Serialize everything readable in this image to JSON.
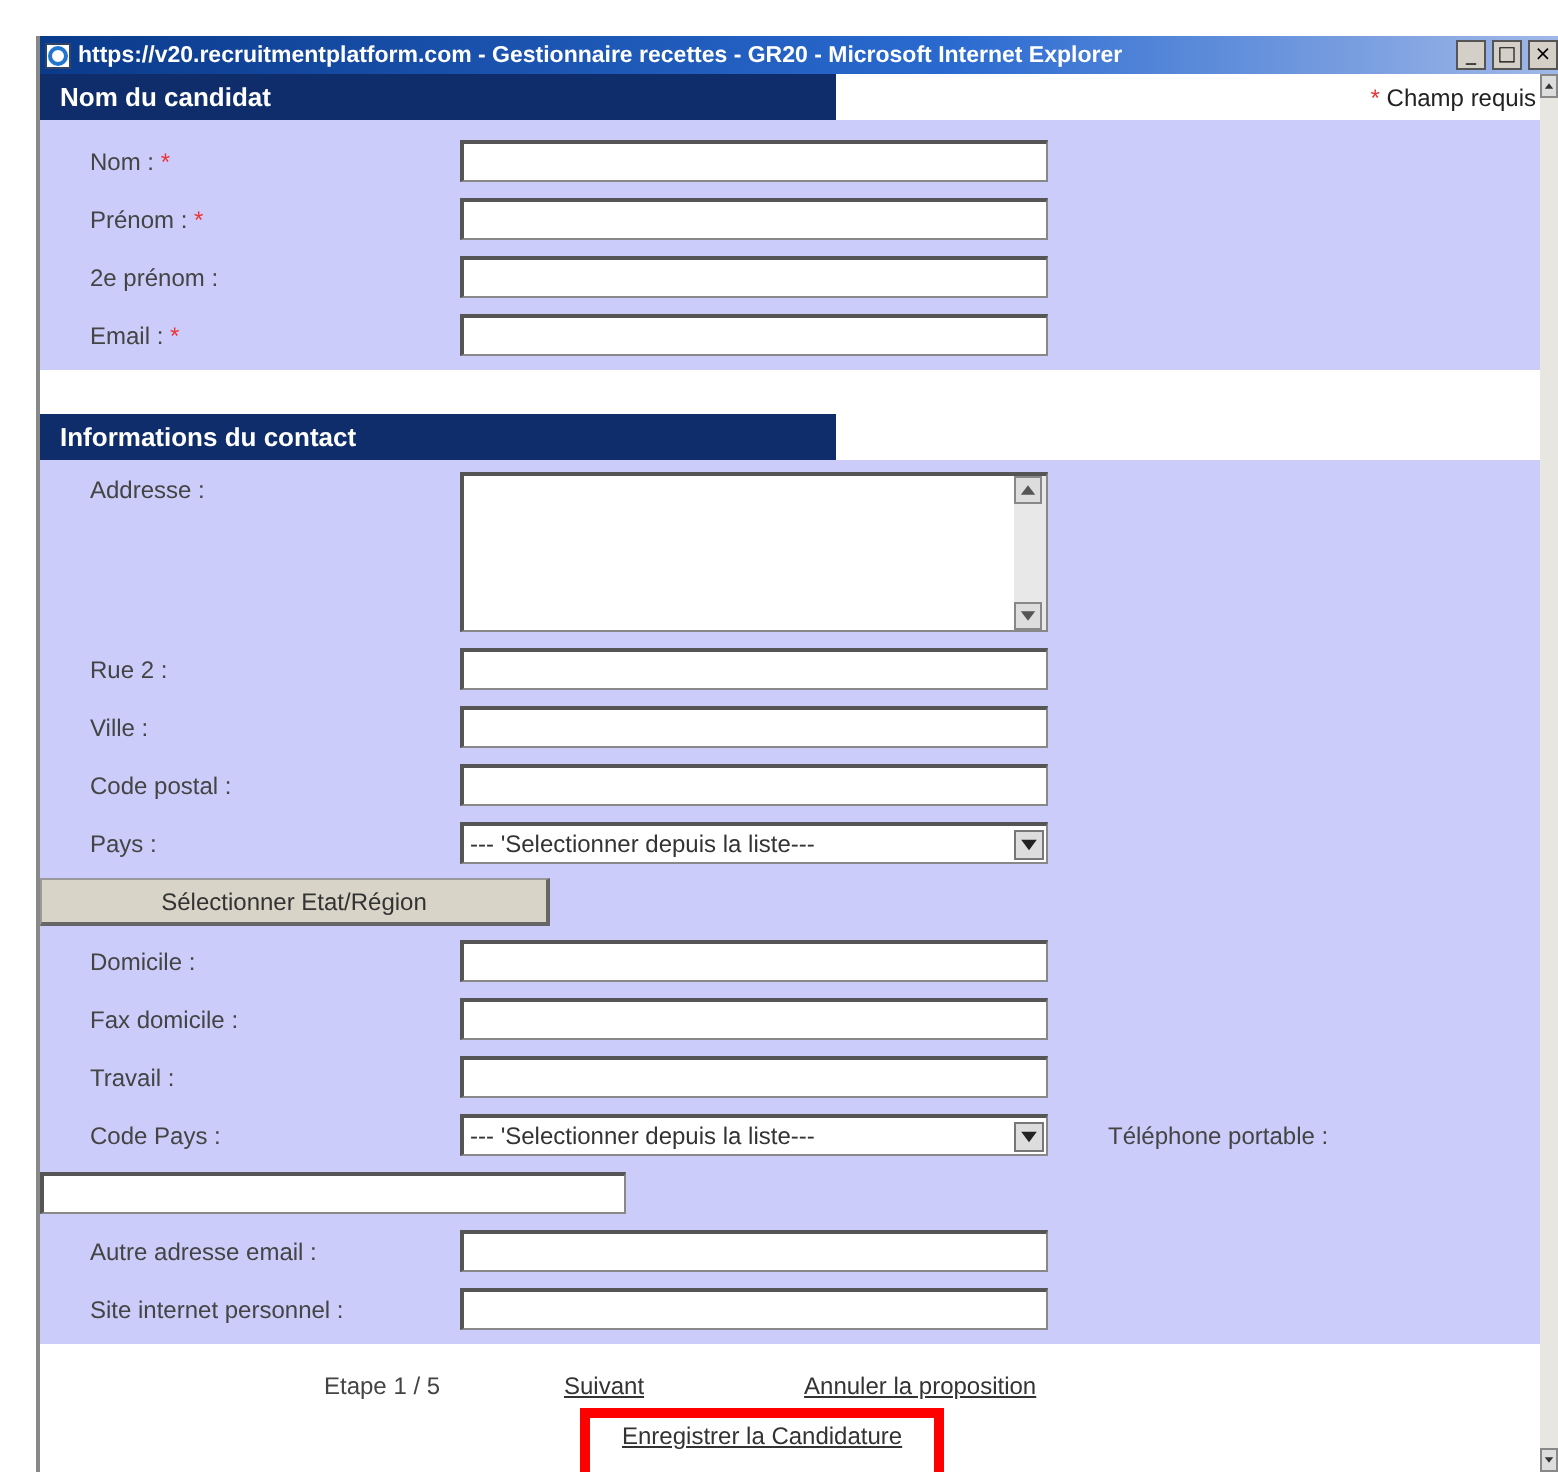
{
  "window": {
    "title": "https://v20.recruitmentplatform.com - Gestionnaire recettes - GR20 - Microsoft Internet Explorer",
    "controls": [
      "_",
      "□",
      "×"
    ]
  },
  "required_note": {
    "mark": "*",
    "text": "Champ requis"
  },
  "sections": [
    {
      "title": "Nom du candidat",
      "fields": [
        {
          "kind": "text",
          "label": "Nom :",
          "required": true
        },
        {
          "kind": "text",
          "label": "Prénom :",
          "required": true
        },
        {
          "kind": "text",
          "label": "2e prénom :",
          "required": false
        },
        {
          "kind": "text",
          "label": "Email :",
          "required": true
        }
      ]
    },
    {
      "title": "Informations du contact",
      "fields": [
        {
          "kind": "textarea",
          "label": "Addresse :",
          "required": false
        },
        {
          "kind": "text",
          "label": "Rue 2 :",
          "required": false
        },
        {
          "kind": "text",
          "label": "Ville :",
          "required": false
        },
        {
          "kind": "text",
          "label": "Code postal :",
          "required": false
        },
        {
          "kind": "select",
          "label": "Pays :",
          "required": false,
          "value": "--- 'Selectionner depuis la liste---"
        },
        {
          "kind": "button",
          "label": "Sélectionner Etat/Région"
        },
        {
          "kind": "text",
          "label": "Domicile :",
          "required": false
        },
        {
          "kind": "text",
          "label": "Fax domicile :",
          "required": false
        },
        {
          "kind": "text",
          "label": "Travail :",
          "required": false
        },
        {
          "kind": "select",
          "label": "Code Pays :",
          "required": false,
          "value": "--- 'Selectionner depuis la liste---",
          "side_label": "Téléphone portable :"
        },
        {
          "kind": "wide_text"
        },
        {
          "kind": "text",
          "label": "Autre adresse email :",
          "required": false
        },
        {
          "kind": "text",
          "label": "Site internet personnel :",
          "required": false
        }
      ]
    }
  ],
  "footer": {
    "step": "Etape 1 / 5",
    "links": [
      {
        "label": "Suivant",
        "highlighted": false
      },
      {
        "label": "Annuler la proposition",
        "highlighted": false
      },
      {
        "label": "Enregistrer la Candidature",
        "highlighted": true
      }
    ]
  }
}
